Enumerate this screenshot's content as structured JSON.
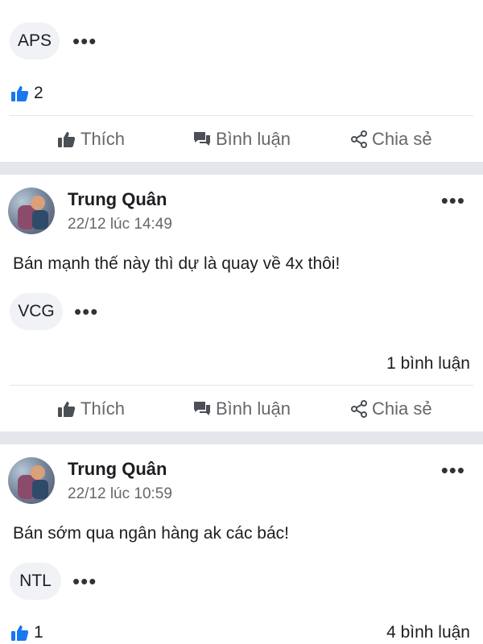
{
  "posts": [
    {
      "tag": "APS",
      "likes": "2",
      "actions": {
        "like": "Thích",
        "comment": "Bình luận",
        "share": "Chia sẻ"
      }
    },
    {
      "author": "Trung Quân",
      "time": "22/12 lúc 14:49",
      "text": "Bán mạnh thế này thì dự là quay về 4x thôi!",
      "tag": "VCG",
      "comments": "1 bình luận",
      "actions": {
        "like": "Thích",
        "comment": "Bình luận",
        "share": "Chia sẻ"
      }
    },
    {
      "author": "Trung Quân",
      "time": "22/12 lúc 10:59",
      "text": "Bán sớm qua ngân hàng ak các bác!",
      "tag": "NTL",
      "likes": "1",
      "comments": "4 bình luận"
    }
  ],
  "icons": {
    "more": "•••",
    "like": "thumbs-up-icon",
    "comment": "comment-icon",
    "share": "share-icon"
  },
  "colors": {
    "like_blue": "#1877f2",
    "muted": "#65676b",
    "divider": "#e4e6eb"
  }
}
